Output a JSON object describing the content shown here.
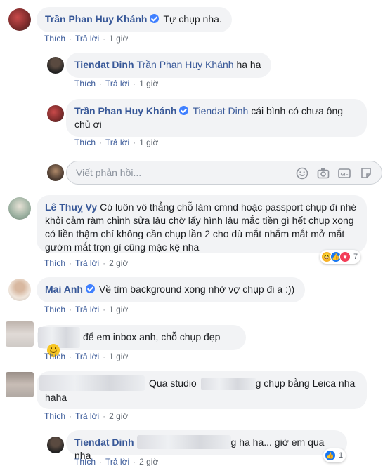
{
  "comments": [
    {
      "name": "Trần Phan Huy Khánh",
      "text": "Tự chụp nha.",
      "like": "Thích",
      "reply": "Trả lời",
      "time": "1 giờ"
    },
    {
      "name": "Tiendat Dinh",
      "mention": "Trần Phan Huy Khánh",
      "text": "ha ha",
      "like": "Thích",
      "reply": "Trả lời",
      "time": "1 giờ"
    },
    {
      "name": "Trần Phan Huy Khánh",
      "mention": "Tiendat Dinh",
      "text1": "cái bình có chưa ông",
      "text2": "chủ ơi",
      "like": "Thích",
      "reply": "Trả lời",
      "time": "1 giờ"
    },
    {
      "name": "Lê Thuỵ Vy",
      "text1": "Có luôn vô thẳng chỗ làm cmnd hoặc passport chụp đi nhé",
      "text2": "khỏi cảm ràm chỉnh sửa lâu chờ lấy hình lâu mắc tiền gì hết chụp xong",
      "text3": "có liền thậm chí không cần chụp lần 2 cho dù mắt nhắm mắt mở mắt",
      "text4": "gườm mắt trọn gì cũng mặc kệ nha",
      "like": "Thích",
      "reply": "Trả lời",
      "time": "2 giờ",
      "reaction_count": "7"
    },
    {
      "name": "Mai Anh",
      "text": "Về tìm background xong nhờ vợ chụp đi a :))",
      "like": "Thích",
      "reply": "Trả lời",
      "time": "1 giờ"
    },
    {
      "text": "để em inbox anh, chỗ chụp đẹp",
      "like": "Thích",
      "reply": "Trả lời",
      "time": "1 giờ"
    },
    {
      "text1a": "Qua studio",
      "text1b": "g chụp bằng Leica nha",
      "text2": "haha",
      "like": "Thích",
      "reply": "Trả lời",
      "time": "2 giờ"
    },
    {
      "name": "Tiendat Dinh",
      "text": "g ha ha... giờ em qua nha",
      "like": "Thích",
      "reply": "Trả lời",
      "time": "2 giờ",
      "reaction_count": "1"
    }
  ],
  "reply_input": {
    "placeholder": "Viết phản hồi..."
  },
  "colors": {
    "link": "#385898",
    "bubble": "#f2f3f5",
    "meta": "#606770"
  }
}
